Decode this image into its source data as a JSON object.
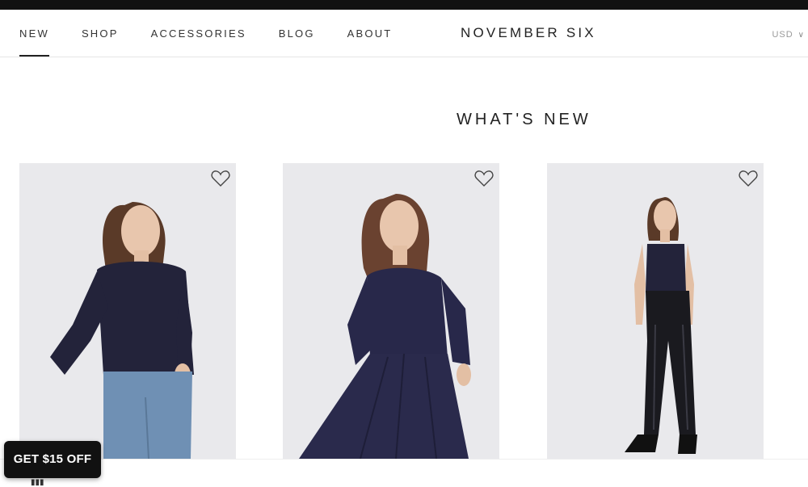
{
  "nav": {
    "items": [
      {
        "label": "NEW",
        "active": true
      },
      {
        "label": "SHOP",
        "active": false
      },
      {
        "label": "ACCESSORIES",
        "active": false
      },
      {
        "label": "BLOG",
        "active": false
      },
      {
        "label": "ABOUT",
        "active": false
      }
    ]
  },
  "brand": {
    "name": "NOVEMBER SIX"
  },
  "currency": {
    "label": "USD",
    "icon": "chevron-down-icon"
  },
  "main": {
    "title": "WHAT'S NEW"
  },
  "products": [
    {
      "wishlist_icon": "heart-icon",
      "image": "model wearing navy top and jeans"
    },
    {
      "wishlist_icon": "heart-icon",
      "image": "model wearing navy dress"
    },
    {
      "wishlist_icon": "heart-icon",
      "image": "model wearing navy camisole and black trousers"
    }
  ],
  "promo": {
    "label": "GET $15 OFF"
  },
  "colors": {
    "accent": "#111111",
    "navy": "#23233a",
    "card_bg": "#e9e9ec"
  }
}
